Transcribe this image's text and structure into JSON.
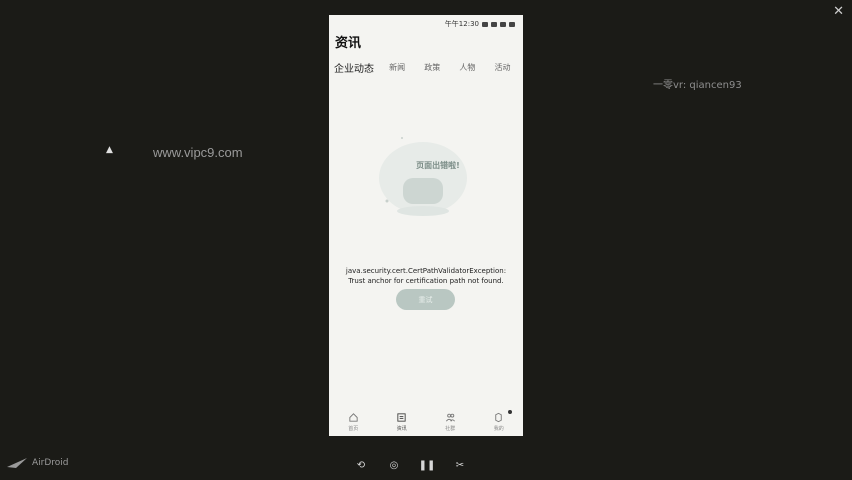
{
  "watermark": "www.vipc9.com",
  "watermark_right": "一零vr: qiancen93",
  "status_time": "午午12:30",
  "screen_title": "资讯",
  "tabs": [
    "企业动态",
    "新闻",
    "政策",
    "人物",
    "活动"
  ],
  "illustration_text": "页面出错啦!",
  "error_message": "java.security.cert.CertPathValidatorException: Trust anchor for certification path not found.",
  "retry_label": "重试",
  "bottom_nav": [
    {
      "label": "首页",
      "icon": "home-icon"
    },
    {
      "label": "资讯",
      "icon": "news-icon"
    },
    {
      "label": "社群",
      "icon": "community-icon"
    },
    {
      "label": "我的",
      "icon": "profile-icon"
    }
  ],
  "app_brand": "AirDroid"
}
